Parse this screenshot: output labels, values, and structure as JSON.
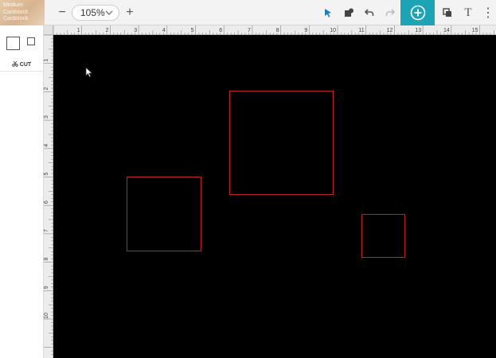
{
  "material": {
    "line1": "Medium",
    "line2": "Cardstock",
    "line3": "Cardstock"
  },
  "zoom": {
    "value": "105%",
    "minus": "−",
    "plus": "+"
  },
  "toolbar": {
    "text_tool": "T",
    "more": "⋮"
  },
  "left_panel": {
    "cut_label": "CUT"
  },
  "ruler": {
    "top_ticks": [
      "1",
      "2",
      "3",
      "4",
      "5",
      "6",
      "7",
      "8",
      "9",
      "10",
      "11",
      "12",
      "13",
      "14",
      "15"
    ],
    "left_ticks": [
      "1",
      "2",
      "3",
      "4",
      "5",
      "6",
      "7",
      "8",
      "9",
      "10"
    ]
  },
  "colors": {
    "accent": "#1ca3b5",
    "cut_line": "#c42222",
    "canvas": "#000000"
  }
}
